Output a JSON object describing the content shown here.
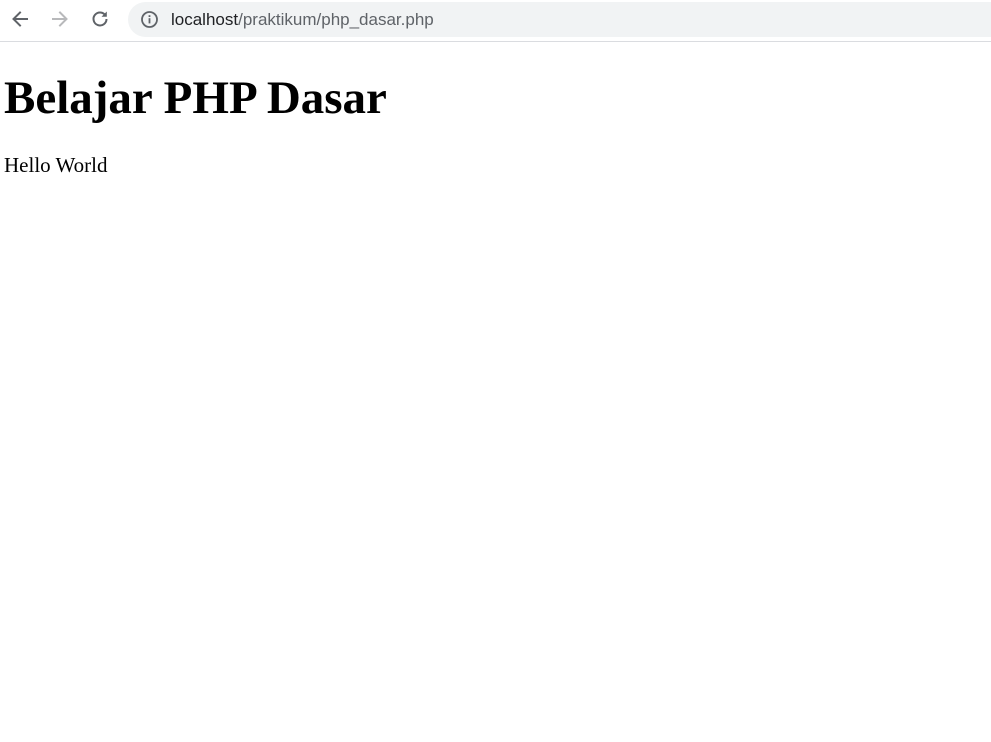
{
  "browser": {
    "url_host": "localhost",
    "url_path": "/praktikum/php_dasar.php",
    "icons": {
      "back": "arrow-left",
      "forward": "arrow-right",
      "reload": "refresh",
      "site_info": "info-circle"
    },
    "colors": {
      "omnibox_bg": "#f1f3f4",
      "icon_active": "#5f6368",
      "icon_disabled": "#b8b9bb"
    }
  },
  "page": {
    "heading": "Belajar PHP Dasar",
    "text": "Hello World"
  }
}
